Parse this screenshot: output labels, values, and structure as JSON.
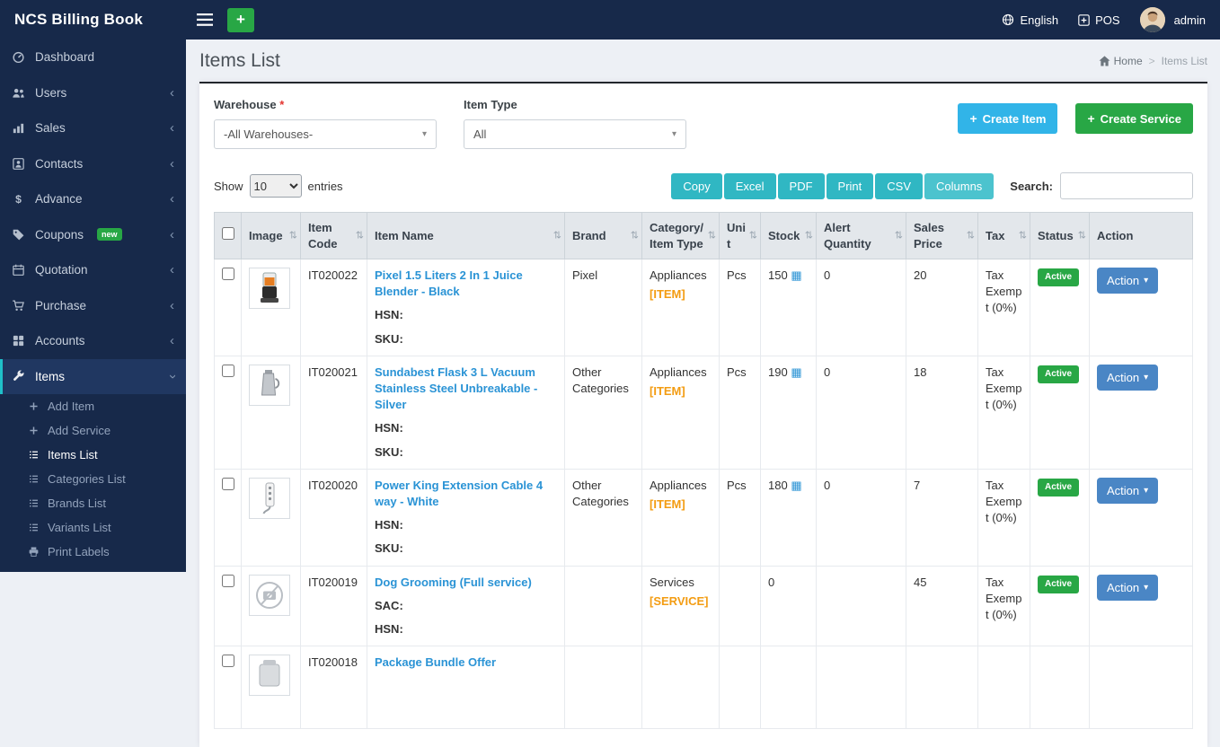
{
  "app": {
    "brand": "NCS Billing Book"
  },
  "topbar": {
    "language": "English",
    "pos_label": "POS",
    "username": "admin"
  },
  "icons": {
    "sort": "⇅",
    "caret": "▾",
    "chevron": "‹",
    "home_label": ""
  },
  "sidebar": {
    "items": [
      {
        "label": "Dashboard"
      },
      {
        "label": "Users"
      },
      {
        "label": "Sales"
      },
      {
        "label": "Contacts"
      },
      {
        "label": "Advance"
      },
      {
        "label": "Coupons",
        "badge": "new"
      },
      {
        "label": "Quotation"
      },
      {
        "label": "Purchase"
      },
      {
        "label": "Accounts"
      },
      {
        "label": "Items"
      }
    ],
    "submenu": [
      {
        "label": "Add Item"
      },
      {
        "label": "Add Service"
      },
      {
        "label": "Items List"
      },
      {
        "label": "Categories List"
      },
      {
        "label": "Brands List"
      },
      {
        "label": "Variants List"
      },
      {
        "label": "Print Labels"
      }
    ]
  },
  "page": {
    "title": "Items List",
    "breadcrumb_home": "Home",
    "breadcrumb_separator": ">",
    "breadcrumb_current": "Items List"
  },
  "filters": {
    "warehouse_label": "Warehouse",
    "warehouse_required": "*",
    "warehouse_value": "-All Warehouses-",
    "item_type_label": "Item Type",
    "item_type_value": "All"
  },
  "toolbar": {
    "create_item": "Create Item",
    "create_service": "Create Service"
  },
  "controls": {
    "show_label": "Show",
    "page_size": "10",
    "entries_label": "entries",
    "buttons": [
      "Copy",
      "Excel",
      "PDF",
      "Print",
      "CSV",
      "Columns"
    ],
    "search_label": "Search:"
  },
  "table": {
    "columns": [
      {
        "label": "Image"
      },
      {
        "label": "Item Code"
      },
      {
        "label": "Item Name"
      },
      {
        "label": "Brand"
      },
      {
        "label": "Category/Item Type"
      },
      {
        "label": "Unit"
      },
      {
        "label": "Stock"
      },
      {
        "label": "Alert Quantity"
      },
      {
        "label": "Sales Price"
      },
      {
        "label": "Tax"
      },
      {
        "label": "Status"
      },
      {
        "label": "Action"
      }
    ],
    "rows": [
      {
        "code": "IT020022",
        "name": "Pixel 1.5 Liters 2 In 1 Juice Blender - Black",
        "line1": "HSN:",
        "line2": "SKU:",
        "brand": "Pixel",
        "category": "Appliances",
        "type_tag": "[ITEM]",
        "unit": "Pcs",
        "stock": "150",
        "stock_icon": "▦",
        "alert": "0",
        "price": "20",
        "tax": "Tax Exempt (0%)",
        "status": "Active",
        "action": "Action"
      },
      {
        "code": "IT020021",
        "name": "Sundabest Flask 3 L Vacuum Stainless Steel Unbreakable - Silver",
        "line1": "HSN:",
        "line2": "SKU:",
        "brand": "Other Categories",
        "category": "Appliances",
        "type_tag": "[ITEM]",
        "unit": "Pcs",
        "stock": "190",
        "stock_icon": "▦",
        "alert": "0",
        "price": "18",
        "tax": "Tax Exempt (0%)",
        "status": "Active",
        "action": "Action"
      },
      {
        "code": "IT020020",
        "name": "Power King Extension Cable 4 way - White",
        "line1": "HSN:",
        "line2": "SKU:",
        "brand": "Other Categories",
        "category": "Appliances",
        "type_tag": "[ITEM]",
        "unit": "Pcs",
        "stock": "180",
        "stock_icon": "▦",
        "alert": "0",
        "price": "7",
        "tax": "Tax Exempt (0%)",
        "status": "Active",
        "action": "Action"
      },
      {
        "code": "IT020019",
        "name": "Dog Grooming (Full service)",
        "line1": "SAC:",
        "line2": "HSN:",
        "brand": "",
        "category": "Services",
        "type_tag": "[SERVICE]",
        "unit": "",
        "stock": "0",
        "stock_icon": "",
        "alert": "",
        "price": "45",
        "tax": "Tax Exempt (0%)",
        "status": "Active",
        "action": "Action"
      },
      {
        "code": "IT020018",
        "name": "Package Bundle Offer",
        "line1": "",
        "line2": "",
        "brand": "",
        "category": "",
        "type_tag": "",
        "unit": "",
        "stock": "",
        "stock_icon": "",
        "alert": "",
        "price": "",
        "tax": "",
        "status": "",
        "action": ""
      }
    ]
  },
  "colors": {
    "navy": "#17294a",
    "teal_accent": "#1fc0c9",
    "green": "#28a745",
    "cyan": "#31b4e8",
    "datatable_teal": "#30b7c3",
    "action_blue": "#4a86c5",
    "link_blue": "#2a93d5",
    "tag_orange": "#f39c12"
  }
}
